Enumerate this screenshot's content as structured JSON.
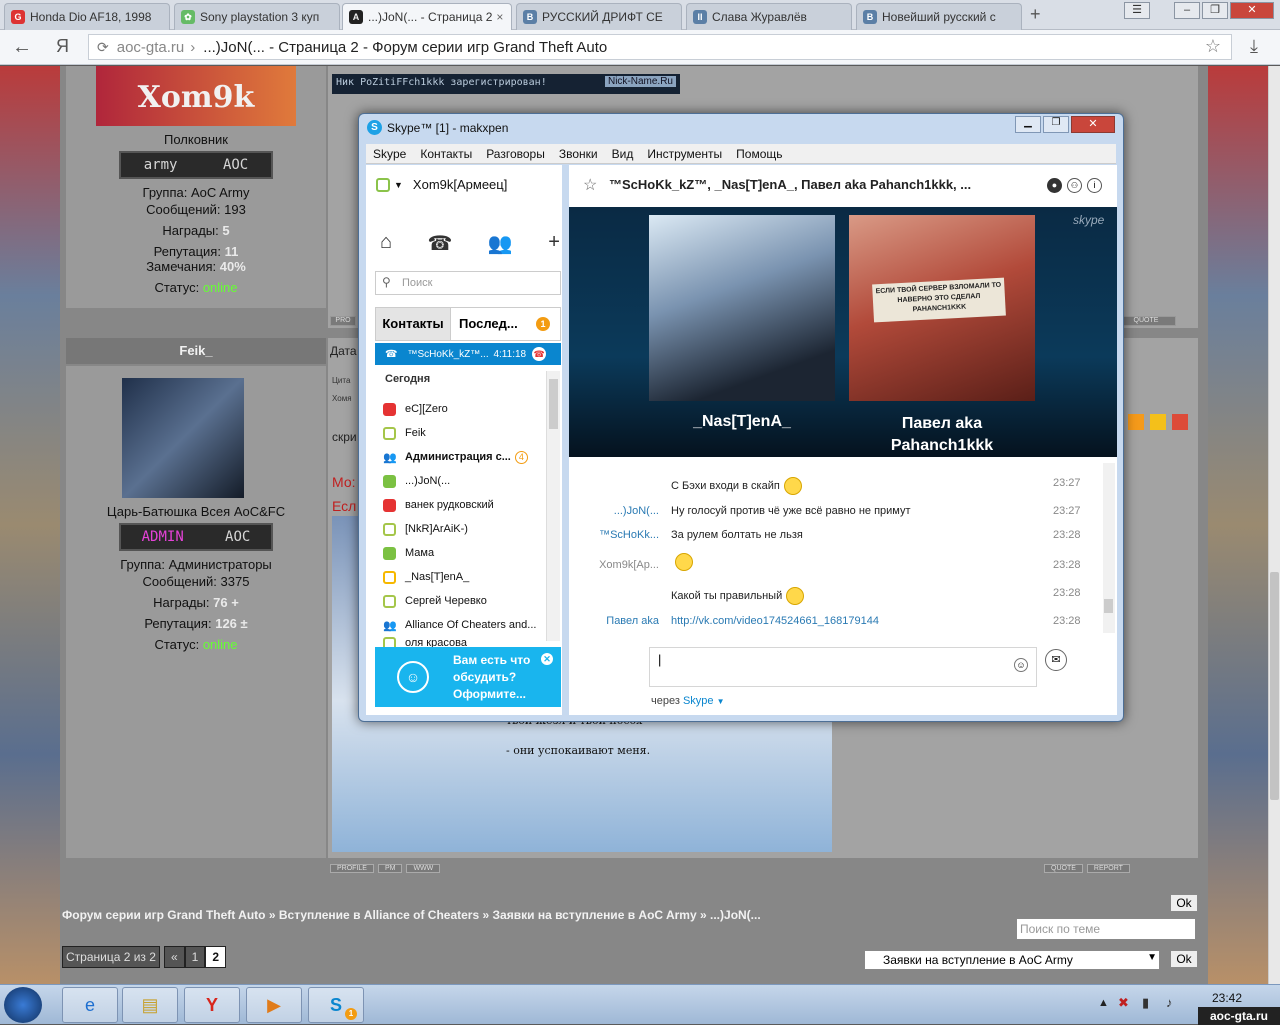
{
  "browser": {
    "tabs": [
      {
        "label": "Honda Dio AF18, 1998",
        "icon": "honda-favicon",
        "active": false
      },
      {
        "label": "Sony playstation 3 куп",
        "icon": "playstation-favicon",
        "active": false
      },
      {
        "label": "...)JoN(... - Страница 2",
        "icon": "aoc-favicon",
        "active": true
      },
      {
        "label": "РУССКИЙ ДРИФТ СЕ",
        "icon": "vk-favicon",
        "active": false
      },
      {
        "label": "Слава Журавлёв",
        "icon": "pause-favicon",
        "active": false
      },
      {
        "label": "Новейший русский с",
        "icon": "vk-favicon",
        "active": false
      }
    ],
    "new_tab": "+",
    "yandex_logo": "Я",
    "address_host": "aoc-gta.ru",
    "address_sep": "›",
    "address_title": "...)JoN(... - Страница 2 - Форум серии игр Grand Theft Auto"
  },
  "forum": {
    "nick_banner": "Ник PoZitiFFch1kkk зарегистрирован!",
    "nick_site": "Nick-Name.Ru",
    "user1": {
      "avatar_text": "Xom9k",
      "rank": "Полковник",
      "badge_left": "army",
      "badge_right": "AOC",
      "group": "Группа: AoC Army",
      "posts_label": "Сообщений:",
      "posts": "193",
      "awards_label": "Награды:",
      "awards": "5",
      "rep_label": "Репутация:",
      "rep": "11",
      "warn_label": "Замечания:",
      "warn": "40%",
      "status_label": "Статус:",
      "status": "online"
    },
    "user2": {
      "name": "Feik_",
      "rank": "Царь-Батюшка Всея AoC&FC",
      "badge_left": "ADMIN",
      "badge_right": "AOC",
      "group": "Группа: Администраторы",
      "posts_label": "Сообщений:",
      "posts": "3375",
      "awards_label": "Награды:",
      "awards": "76",
      "plus": "+",
      "rep_label": "Репутация:",
      "rep": "126",
      "pm": "±",
      "status_label": "Статус:",
      "status": "online"
    },
    "date_label": "Дата",
    "quote_label": "Цита",
    "quote_sub": "Хомя",
    "post_fragment_1": "скри",
    "post_fragment_2": "Мо:",
    "post_fragment_3": "Есл",
    "post_line_1": "твой жезл и твой посох -",
    "post_line_2": "- они успокаивают меня.",
    "post_buttons": [
      "PROFILE",
      "PM",
      "WWW"
    ],
    "post_buttons_right": [
      "QUOTE",
      "REPORT"
    ],
    "breadcrumb": [
      "Форум серии игр Grand Theft Auto",
      "Вступление в Alliance of Cheaters",
      "Заявки на вступление в AoC Army",
      "...)JoN(..."
    ],
    "breadcrumb_sep": "»",
    "ok_label": "Ok",
    "search_placeholder": "Поиск по теме",
    "pages_label": "Страница 2 из 2",
    "page_prev": "«",
    "page_1": "1",
    "page_2": "2",
    "forum_select": "Заявки на вступление в AoC Army"
  },
  "skype": {
    "title": "Skype™ [1] - makxpen",
    "menu": [
      "Skype",
      "Контакты",
      "Разговоры",
      "Звонки",
      "Вид",
      "Инструменты",
      "Помощь"
    ],
    "my_name": "Xom9k[Армеец]",
    "search_placeholder": "Поиск",
    "tab_contacts": "Контакты",
    "tab_recent": "Послед...",
    "recent_badge": "1",
    "active_call": {
      "name": "™ScHoKk_kZ™...",
      "time": "4:11:18"
    },
    "section_today": "Сегодня",
    "contacts": [
      {
        "name": "eC][Zero",
        "status": "red"
      },
      {
        "name": "Feik",
        "status": "off"
      },
      {
        "name": "Администрация с...",
        "status": "grp",
        "badge": "4"
      },
      {
        "name": "...)JoN(...",
        "status": "green"
      },
      {
        "name": "ванек рудковский",
        "status": "red"
      },
      {
        "name": "[NkR]ArAiK-)",
        "status": "off"
      },
      {
        "name": "Мама",
        "status": "green"
      },
      {
        "name": "_Nas[T]enA_",
        "status": "yel"
      },
      {
        "name": "Сергей Черевко",
        "status": "off"
      },
      {
        "name": "Alliance Of Cheaters and...",
        "status": "grp"
      },
      {
        "name": "оля красова",
        "status": "off"
      }
    ],
    "promo": "Вам есть что обсудить? Оформите...",
    "conversation_title": "™ScHoKk_kZ™, _Nas[T]enA_, Павел aka Pahanch1kkk, ...",
    "skype_watermark": "skype",
    "video": [
      {
        "name": "_Nas[T]enA_"
      },
      {
        "name": "Павел aka Pahanch1kkk",
        "sign": "ЕСЛИ ТВОЙ СЕРВЕР ВЗЛОМАЛИ ТО НАВЕРНО ЭТО СДЕЛАЛ PAHANCH1KKK"
      }
    ],
    "messages": [
      {
        "who": "",
        "text": "С Бэхи входи в скайп",
        "smile": true,
        "time": "23:27"
      },
      {
        "who": "...)JoN(...",
        "text": "Ну голосуй против чё уже всё равно не примут",
        "smile": false,
        "time": "23:27"
      },
      {
        "who": "™ScHoKk...",
        "text": "За рулем болтать не льзя",
        "smile": false,
        "time": "23:28"
      },
      {
        "who": "Xom9k[Ap...",
        "text": "",
        "smile": true,
        "time": "23:28"
      },
      {
        "who": "",
        "text": "Какой ты правильный",
        "smile": true,
        "time": "23:28"
      },
      {
        "who": "Павел aka",
        "text": "http://vk.com/video174524661_168179144",
        "smile": false,
        "time": "23:28"
      }
    ],
    "via_label": "через",
    "via_value": "Skype"
  },
  "taskbar": {
    "clock": "23:42",
    "watermark": "aoc-gta.ru",
    "skype_badge": "1"
  }
}
